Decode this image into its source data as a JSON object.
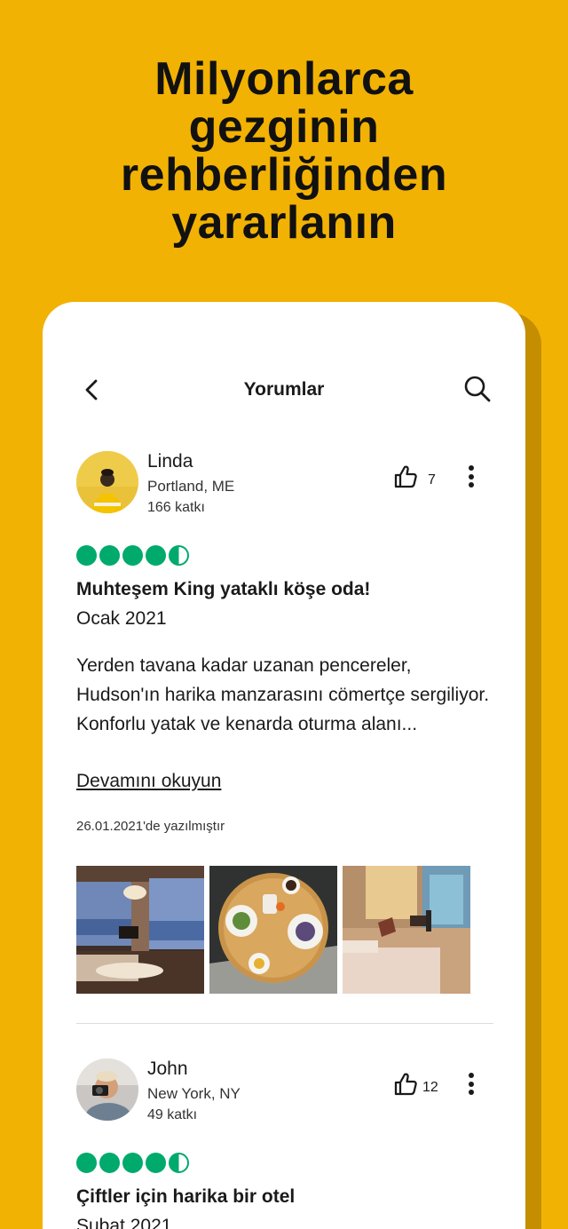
{
  "headline": [
    "Milyonlarca",
    "gezginin",
    "rehberliğinden",
    "yararlanın"
  ],
  "topbar": {
    "title": "Yorumlar",
    "back_icon": "chevron-left-icon",
    "search_icon": "search-icon"
  },
  "colors": {
    "background": "#F2B203",
    "bubble": "#00AA6C",
    "text": "#1a1a1a"
  },
  "reviews": [
    {
      "user": "Linda",
      "location": "Portland, ME",
      "contributions": "166 katkı",
      "likes": "7",
      "rating": 4.5,
      "title": "Muhteşem King yataklı köşe oda!",
      "date": "Ocak 2021",
      "body": "Yerden tavana kadar uzanan pencereler, Hudson'ın harika manzarasını cömertçe sergiliyor. Konforlu yatak ve kenarda oturma alanı...",
      "read_more": "Devamını okuyun",
      "written": "26.01.2021'de yazılmıştır",
      "photos": [
        "hotel-room-river-view-photo",
        "breakfast-table-photo",
        "hotel-room-bed-photo"
      ]
    },
    {
      "user": "John",
      "location": "New York, NY",
      "contributions": "49 katkı",
      "likes": "12",
      "rating": 4.5,
      "title": "Çiftler için harika bir otel",
      "date": "Şubat 2021"
    }
  ]
}
